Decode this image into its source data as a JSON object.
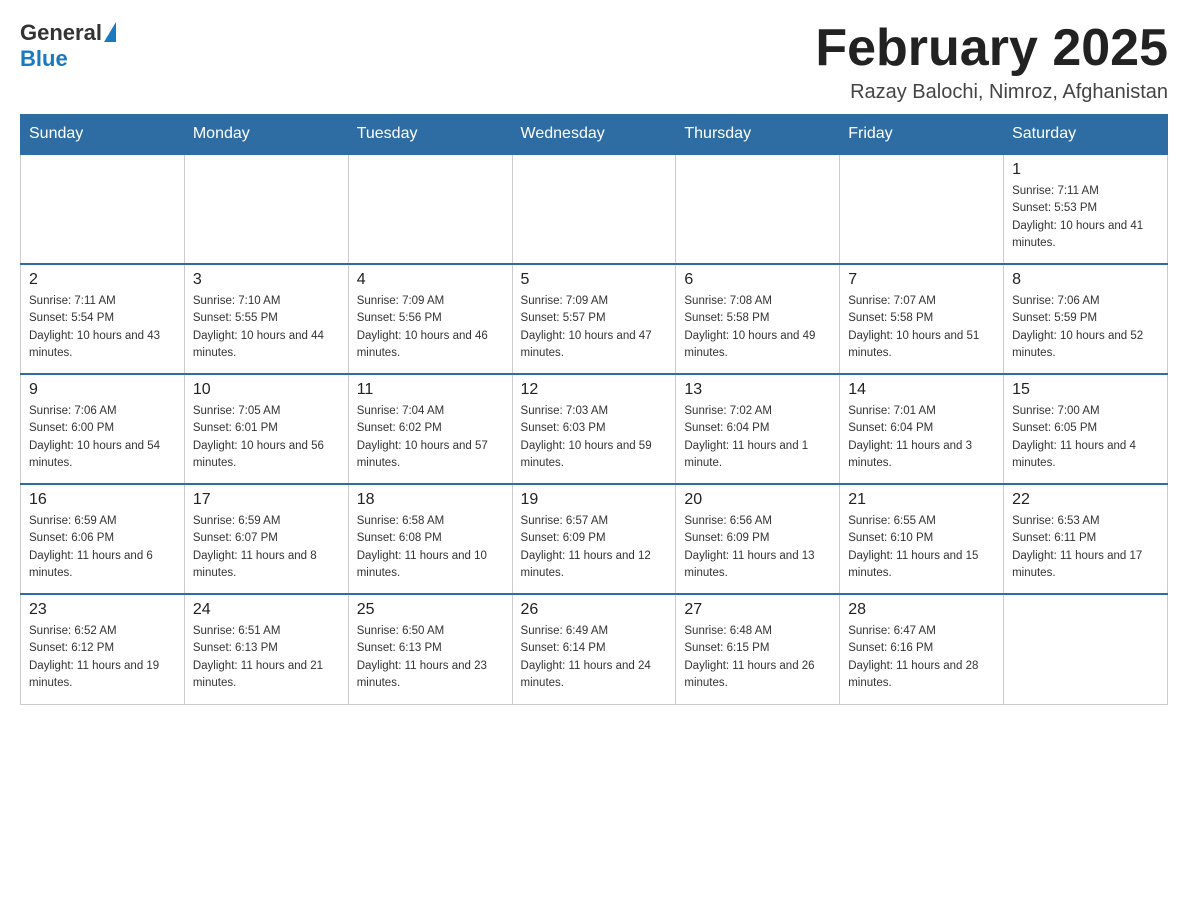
{
  "logo": {
    "general": "General",
    "blue": "Blue"
  },
  "header": {
    "month_year": "February 2025",
    "location": "Razay Balochi, Nimroz, Afghanistan"
  },
  "weekdays": [
    "Sunday",
    "Monday",
    "Tuesday",
    "Wednesday",
    "Thursday",
    "Friday",
    "Saturday"
  ],
  "weeks": [
    [
      {
        "day": "",
        "sunrise": "",
        "sunset": "",
        "daylight": ""
      },
      {
        "day": "",
        "sunrise": "",
        "sunset": "",
        "daylight": ""
      },
      {
        "day": "",
        "sunrise": "",
        "sunset": "",
        "daylight": ""
      },
      {
        "day": "",
        "sunrise": "",
        "sunset": "",
        "daylight": ""
      },
      {
        "day": "",
        "sunrise": "",
        "sunset": "",
        "daylight": ""
      },
      {
        "day": "",
        "sunrise": "",
        "sunset": "",
        "daylight": ""
      },
      {
        "day": "1",
        "sunrise": "Sunrise: 7:11 AM",
        "sunset": "Sunset: 5:53 PM",
        "daylight": "Daylight: 10 hours and 41 minutes."
      }
    ],
    [
      {
        "day": "2",
        "sunrise": "Sunrise: 7:11 AM",
        "sunset": "Sunset: 5:54 PM",
        "daylight": "Daylight: 10 hours and 43 minutes."
      },
      {
        "day": "3",
        "sunrise": "Sunrise: 7:10 AM",
        "sunset": "Sunset: 5:55 PM",
        "daylight": "Daylight: 10 hours and 44 minutes."
      },
      {
        "day": "4",
        "sunrise": "Sunrise: 7:09 AM",
        "sunset": "Sunset: 5:56 PM",
        "daylight": "Daylight: 10 hours and 46 minutes."
      },
      {
        "day": "5",
        "sunrise": "Sunrise: 7:09 AM",
        "sunset": "Sunset: 5:57 PM",
        "daylight": "Daylight: 10 hours and 47 minutes."
      },
      {
        "day": "6",
        "sunrise": "Sunrise: 7:08 AM",
        "sunset": "Sunset: 5:58 PM",
        "daylight": "Daylight: 10 hours and 49 minutes."
      },
      {
        "day": "7",
        "sunrise": "Sunrise: 7:07 AM",
        "sunset": "Sunset: 5:58 PM",
        "daylight": "Daylight: 10 hours and 51 minutes."
      },
      {
        "day": "8",
        "sunrise": "Sunrise: 7:06 AM",
        "sunset": "Sunset: 5:59 PM",
        "daylight": "Daylight: 10 hours and 52 minutes."
      }
    ],
    [
      {
        "day": "9",
        "sunrise": "Sunrise: 7:06 AM",
        "sunset": "Sunset: 6:00 PM",
        "daylight": "Daylight: 10 hours and 54 minutes."
      },
      {
        "day": "10",
        "sunrise": "Sunrise: 7:05 AM",
        "sunset": "Sunset: 6:01 PM",
        "daylight": "Daylight: 10 hours and 56 minutes."
      },
      {
        "day": "11",
        "sunrise": "Sunrise: 7:04 AM",
        "sunset": "Sunset: 6:02 PM",
        "daylight": "Daylight: 10 hours and 57 minutes."
      },
      {
        "day": "12",
        "sunrise": "Sunrise: 7:03 AM",
        "sunset": "Sunset: 6:03 PM",
        "daylight": "Daylight: 10 hours and 59 minutes."
      },
      {
        "day": "13",
        "sunrise": "Sunrise: 7:02 AM",
        "sunset": "Sunset: 6:04 PM",
        "daylight": "Daylight: 11 hours and 1 minute."
      },
      {
        "day": "14",
        "sunrise": "Sunrise: 7:01 AM",
        "sunset": "Sunset: 6:04 PM",
        "daylight": "Daylight: 11 hours and 3 minutes."
      },
      {
        "day": "15",
        "sunrise": "Sunrise: 7:00 AM",
        "sunset": "Sunset: 6:05 PM",
        "daylight": "Daylight: 11 hours and 4 minutes."
      }
    ],
    [
      {
        "day": "16",
        "sunrise": "Sunrise: 6:59 AM",
        "sunset": "Sunset: 6:06 PM",
        "daylight": "Daylight: 11 hours and 6 minutes."
      },
      {
        "day": "17",
        "sunrise": "Sunrise: 6:59 AM",
        "sunset": "Sunset: 6:07 PM",
        "daylight": "Daylight: 11 hours and 8 minutes."
      },
      {
        "day": "18",
        "sunrise": "Sunrise: 6:58 AM",
        "sunset": "Sunset: 6:08 PM",
        "daylight": "Daylight: 11 hours and 10 minutes."
      },
      {
        "day": "19",
        "sunrise": "Sunrise: 6:57 AM",
        "sunset": "Sunset: 6:09 PM",
        "daylight": "Daylight: 11 hours and 12 minutes."
      },
      {
        "day": "20",
        "sunrise": "Sunrise: 6:56 AM",
        "sunset": "Sunset: 6:09 PM",
        "daylight": "Daylight: 11 hours and 13 minutes."
      },
      {
        "day": "21",
        "sunrise": "Sunrise: 6:55 AM",
        "sunset": "Sunset: 6:10 PM",
        "daylight": "Daylight: 11 hours and 15 minutes."
      },
      {
        "day": "22",
        "sunrise": "Sunrise: 6:53 AM",
        "sunset": "Sunset: 6:11 PM",
        "daylight": "Daylight: 11 hours and 17 minutes."
      }
    ],
    [
      {
        "day": "23",
        "sunrise": "Sunrise: 6:52 AM",
        "sunset": "Sunset: 6:12 PM",
        "daylight": "Daylight: 11 hours and 19 minutes."
      },
      {
        "day": "24",
        "sunrise": "Sunrise: 6:51 AM",
        "sunset": "Sunset: 6:13 PM",
        "daylight": "Daylight: 11 hours and 21 minutes."
      },
      {
        "day": "25",
        "sunrise": "Sunrise: 6:50 AM",
        "sunset": "Sunset: 6:13 PM",
        "daylight": "Daylight: 11 hours and 23 minutes."
      },
      {
        "day": "26",
        "sunrise": "Sunrise: 6:49 AM",
        "sunset": "Sunset: 6:14 PM",
        "daylight": "Daylight: 11 hours and 24 minutes."
      },
      {
        "day": "27",
        "sunrise": "Sunrise: 6:48 AM",
        "sunset": "Sunset: 6:15 PM",
        "daylight": "Daylight: 11 hours and 26 minutes."
      },
      {
        "day": "28",
        "sunrise": "Sunrise: 6:47 AM",
        "sunset": "Sunset: 6:16 PM",
        "daylight": "Daylight: 11 hours and 28 minutes."
      },
      {
        "day": "",
        "sunrise": "",
        "sunset": "",
        "daylight": ""
      }
    ]
  ]
}
